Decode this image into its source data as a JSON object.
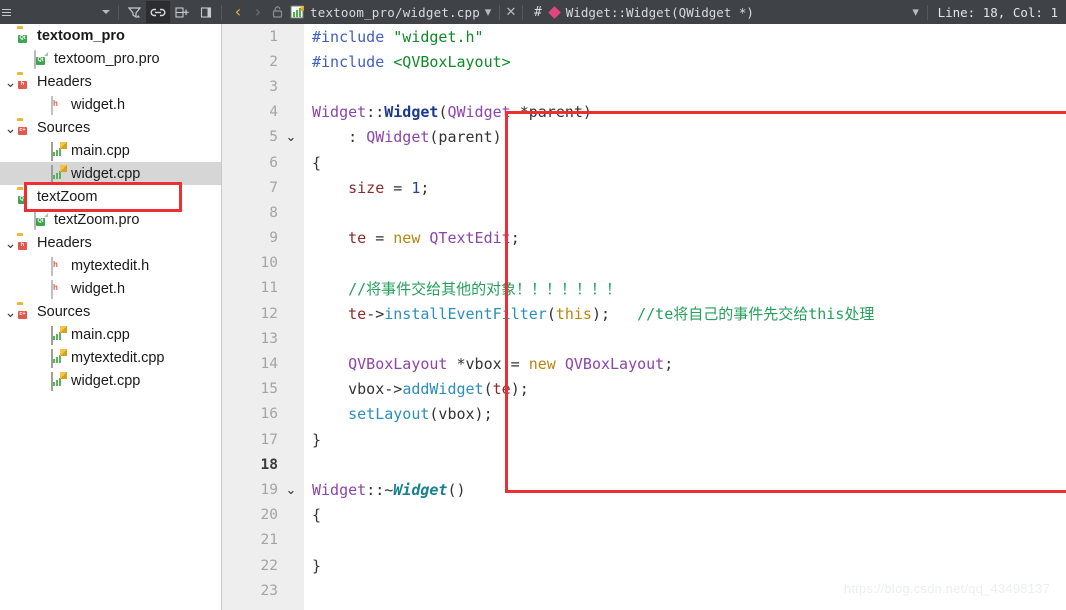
{
  "toolbar": {
    "menu_icon": "hamburger-icon",
    "dropdown_icon": "chevron-down-icon",
    "filter_icon": "filter-icon",
    "link_icon": "link-sync-icon",
    "split_icon": "split-add-icon",
    "panel_icon": "close-panel-icon",
    "back_icon": "chevron-left-icon",
    "forward_icon": "chevron-right-icon",
    "lock_icon": "unlocked-icon",
    "file_icon": "cpp-file-icon",
    "file_path": "textoom_pro/widget.cpp",
    "file_dropdown_icon": "chevron-down-icon",
    "close_icon": "close-icon",
    "hash_label": "#",
    "symbol_icon": "method-diamond-icon",
    "symbol_label": "Widget::Widget(QWidget *)",
    "symbol_dropdown_icon": "chevron-down-icon",
    "cursor_position": "Line: 18, Col: 1"
  },
  "sidebar": {
    "items": [
      {
        "label": "textoom_pro",
        "indent": 0,
        "arrow": "",
        "icon": "qt-project-folder-icon",
        "bold": true,
        "selected": false
      },
      {
        "label": "textoom_pro.pro",
        "indent": 1,
        "arrow": "",
        "icon": "pro-file-icon",
        "bold": false,
        "selected": false
      },
      {
        "label": "Headers",
        "indent": 0,
        "arrow": "v",
        "icon": "headers-folder-icon",
        "bold": false,
        "selected": false
      },
      {
        "label": "widget.h",
        "indent": 2,
        "arrow": "",
        "icon": "h-file-icon",
        "bold": false,
        "selected": false
      },
      {
        "label": "Sources",
        "indent": 0,
        "arrow": "v",
        "icon": "sources-folder-icon",
        "bold": false,
        "selected": false
      },
      {
        "label": "main.cpp",
        "indent": 2,
        "arrow": "",
        "icon": "cpp-file-icon",
        "bold": false,
        "selected": false
      },
      {
        "label": "widget.cpp",
        "indent": 2,
        "arrow": "",
        "icon": "cpp-file-icon",
        "bold": false,
        "selected": true
      },
      {
        "label": "textZoom",
        "indent": 0,
        "arrow": "",
        "icon": "qt-project-folder-icon",
        "bold": false,
        "selected": false
      },
      {
        "label": "textZoom.pro",
        "indent": 1,
        "arrow": "",
        "icon": "pro-file-icon",
        "bold": false,
        "selected": false
      },
      {
        "label": "Headers",
        "indent": 0,
        "arrow": "v",
        "icon": "headers-folder-icon",
        "bold": false,
        "selected": false
      },
      {
        "label": "mytextedit.h",
        "indent": 2,
        "arrow": "",
        "icon": "h-file-icon",
        "bold": false,
        "selected": false
      },
      {
        "label": "widget.h",
        "indent": 2,
        "arrow": "",
        "icon": "h-file-icon",
        "bold": false,
        "selected": false
      },
      {
        "label": "Sources",
        "indent": 0,
        "arrow": "v",
        "icon": "sources-folder-icon",
        "bold": false,
        "selected": false
      },
      {
        "label": "main.cpp",
        "indent": 2,
        "arrow": "",
        "icon": "cpp-file-icon",
        "bold": false,
        "selected": false
      },
      {
        "label": "mytextedit.cpp",
        "indent": 2,
        "arrow": "",
        "icon": "cpp-file-icon",
        "bold": false,
        "selected": false
      },
      {
        "label": "widget.cpp",
        "indent": 2,
        "arrow": "",
        "icon": "cpp-file-icon",
        "bold": false,
        "selected": false
      }
    ]
  },
  "editor": {
    "current_line": 18,
    "lines": [
      {
        "n": "1",
        "fold": "",
        "tokens": [
          {
            "t": "#include ",
            "c": "k-pre"
          },
          {
            "t": "\"widget.h\"",
            "c": "k-str"
          }
        ]
      },
      {
        "n": "2",
        "fold": "",
        "tokens": [
          {
            "t": "#include ",
            "c": "k-pre"
          },
          {
            "t": "<QVBoxLayout>",
            "c": "k-str"
          }
        ]
      },
      {
        "n": "3",
        "fold": "",
        "tokens": []
      },
      {
        "n": "4",
        "fold": "",
        "tokens": [
          {
            "t": "Widget",
            "c": "k-cls"
          },
          {
            "t": "::",
            "c": "k-op"
          },
          {
            "t": "Widget",
            "c": "k-cls-b"
          },
          {
            "t": "(",
            "c": "k-op"
          },
          {
            "t": "QWidget",
            "c": "k-cls"
          },
          {
            "t": " *parent)",
            "c": "k-op"
          }
        ]
      },
      {
        "n": "5",
        "fold": "v",
        "tokens": [
          {
            "t": "    : ",
            "c": "k-op"
          },
          {
            "t": "QWidget",
            "c": "k-cls"
          },
          {
            "t": "(parent)",
            "c": "k-op"
          }
        ]
      },
      {
        "n": "6",
        "fold": "",
        "tokens": [
          {
            "t": "{",
            "c": "k-op"
          }
        ]
      },
      {
        "n": "7",
        "fold": "",
        "tokens": [
          {
            "t": "    ",
            "c": "k-op"
          },
          {
            "t": "size",
            "c": "k-var"
          },
          {
            "t": " = ",
            "c": "k-op"
          },
          {
            "t": "1",
            "c": "k-num"
          },
          {
            "t": ";",
            "c": "k-op"
          }
        ]
      },
      {
        "n": "8",
        "fold": "",
        "tokens": []
      },
      {
        "n": "9",
        "fold": "",
        "tokens": [
          {
            "t": "    ",
            "c": "k-op"
          },
          {
            "t": "te",
            "c": "k-var"
          },
          {
            "t": " = ",
            "c": "k-op"
          },
          {
            "t": "new",
            "c": "k-kw"
          },
          {
            "t": " ",
            "c": "k-op"
          },
          {
            "t": "QTextEdit",
            "c": "k-cls"
          },
          {
            "t": ";",
            "c": "k-op"
          }
        ]
      },
      {
        "n": "10",
        "fold": "",
        "tokens": []
      },
      {
        "n": "11",
        "fold": "",
        "tokens": [
          {
            "t": "    //将事件交给其他的对象！！！！！！！",
            "c": "k-cmt"
          }
        ]
      },
      {
        "n": "12",
        "fold": "",
        "tokens": [
          {
            "t": "    ",
            "c": "k-op"
          },
          {
            "t": "te",
            "c": "k-var"
          },
          {
            "t": "->",
            "c": "k-op"
          },
          {
            "t": "installEventFilter",
            "c": "k-fn"
          },
          {
            "t": "(",
            "c": "k-op"
          },
          {
            "t": "this",
            "c": "k-kw"
          },
          {
            "t": ");   ",
            "c": "k-op"
          },
          {
            "t": "//te将自己的事件先交给this处理",
            "c": "k-cmt"
          }
        ]
      },
      {
        "n": "13",
        "fold": "",
        "tokens": []
      },
      {
        "n": "14",
        "fold": "",
        "tokens": [
          {
            "t": "    ",
            "c": "k-op"
          },
          {
            "t": "QVBoxLayout",
            "c": "k-cls"
          },
          {
            "t": " *vbox = ",
            "c": "k-op"
          },
          {
            "t": "new",
            "c": "k-kw"
          },
          {
            "t": " ",
            "c": "k-op"
          },
          {
            "t": "QVBoxLayout",
            "c": "k-cls"
          },
          {
            "t": ";",
            "c": "k-op"
          }
        ]
      },
      {
        "n": "15",
        "fold": "",
        "tokens": [
          {
            "t": "    vbox->",
            "c": "k-op"
          },
          {
            "t": "addWidget",
            "c": "k-fn"
          },
          {
            "t": "(",
            "c": "k-op"
          },
          {
            "t": "te",
            "c": "k-var"
          },
          {
            "t": ");",
            "c": "k-op"
          }
        ]
      },
      {
        "n": "16",
        "fold": "",
        "tokens": [
          {
            "t": "    ",
            "c": "k-op"
          },
          {
            "t": "setLayout",
            "c": "k-fn"
          },
          {
            "t": "(vbox);",
            "c": "k-op"
          }
        ]
      },
      {
        "n": "17",
        "fold": "",
        "tokens": [
          {
            "t": "}",
            "c": "k-op"
          }
        ]
      },
      {
        "n": "18",
        "fold": "",
        "tokens": []
      },
      {
        "n": "19",
        "fold": "v",
        "tokens": [
          {
            "t": "Widget",
            "c": "k-cls"
          },
          {
            "t": "::~",
            "c": "k-op"
          },
          {
            "t": "Widget",
            "c": "k-dtor"
          },
          {
            "t": "()",
            "c": "k-op"
          }
        ]
      },
      {
        "n": "20",
        "fold": "",
        "tokens": [
          {
            "t": "{",
            "c": "k-op"
          }
        ]
      },
      {
        "n": "21",
        "fold": "",
        "tokens": []
      },
      {
        "n": "22",
        "fold": "",
        "tokens": [
          {
            "t": "}",
            "c": "k-op"
          }
        ]
      },
      {
        "n": "23",
        "fold": "",
        "tokens": []
      }
    ]
  },
  "watermark": {
    "text": "https://blog.csdn.net/qq_43498137"
  },
  "colors": {
    "chrome": "#3f4246",
    "annotation_red": "#ec2f33",
    "gutter": "#eeeeee",
    "selection": "#d6d6d6"
  }
}
